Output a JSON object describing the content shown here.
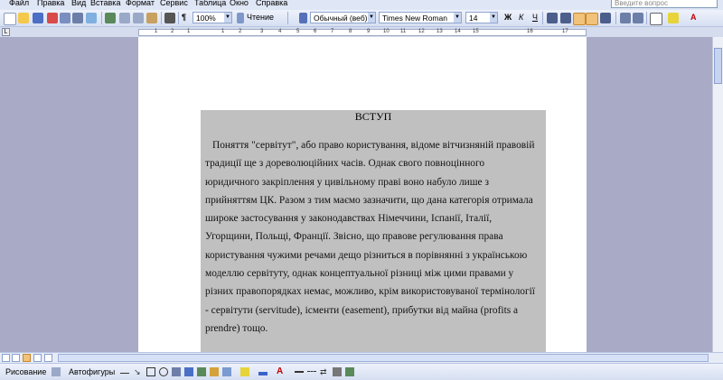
{
  "menu": {
    "items": [
      "Файл",
      "Правка",
      "Вид",
      "Вставка",
      "Формат",
      "Сервис",
      "Таблица",
      "Окно",
      "Справка"
    ],
    "question_placeholder": "Введите вопрос"
  },
  "toolbar": {
    "zoom": "100%",
    "reading_label": "Чтение",
    "style": "Обычный (веб)",
    "font": "Times New Roman",
    "size": "14",
    "bold_label": "Ж",
    "italic_label": "К",
    "underline_label": "Ч"
  },
  "ruler": {
    "numbers": [
      "1",
      "2",
      "1",
      "1",
      "2",
      "3",
      "4",
      "5",
      "6",
      "7",
      "8",
      "9",
      "10",
      "11",
      "12",
      "13",
      "14",
      "15",
      "16",
      "17"
    ]
  },
  "document": {
    "heading": "ВСТУП",
    "lines": [
      "Поняття \"сервітут\", або право користування, відоме вітчизняній правовій",
      "традиції ще з дореволюційних часів. Однак свого повноцінного",
      "юридичного закріплення у цивільному праві воно набуло лише з",
      "прийняттям ЦК. Разом з тим маємо зазначити, що дана категорія отримала",
      "широке застосування у законодавствах Німеччини, Іспанії, Італії,",
      "Угорщини, Польщі, Франції. Звісно, що правове регулювання права",
      "користування чужими речами дещо різниться в порівнянні з українською",
      "моделлю сервітуту, однак концептуальної різниці між цими правами у",
      "різних правопорядках немає, можливо, крім використовуваної термінології",
      "- сервітути (servitude), ісменти (easement), прибутки від майна (profits a",
      "prendre) тощо."
    ]
  },
  "drawing_toolbar": {
    "draw_label": "Рисование",
    "autoshapes_label": "Автофигуры"
  }
}
